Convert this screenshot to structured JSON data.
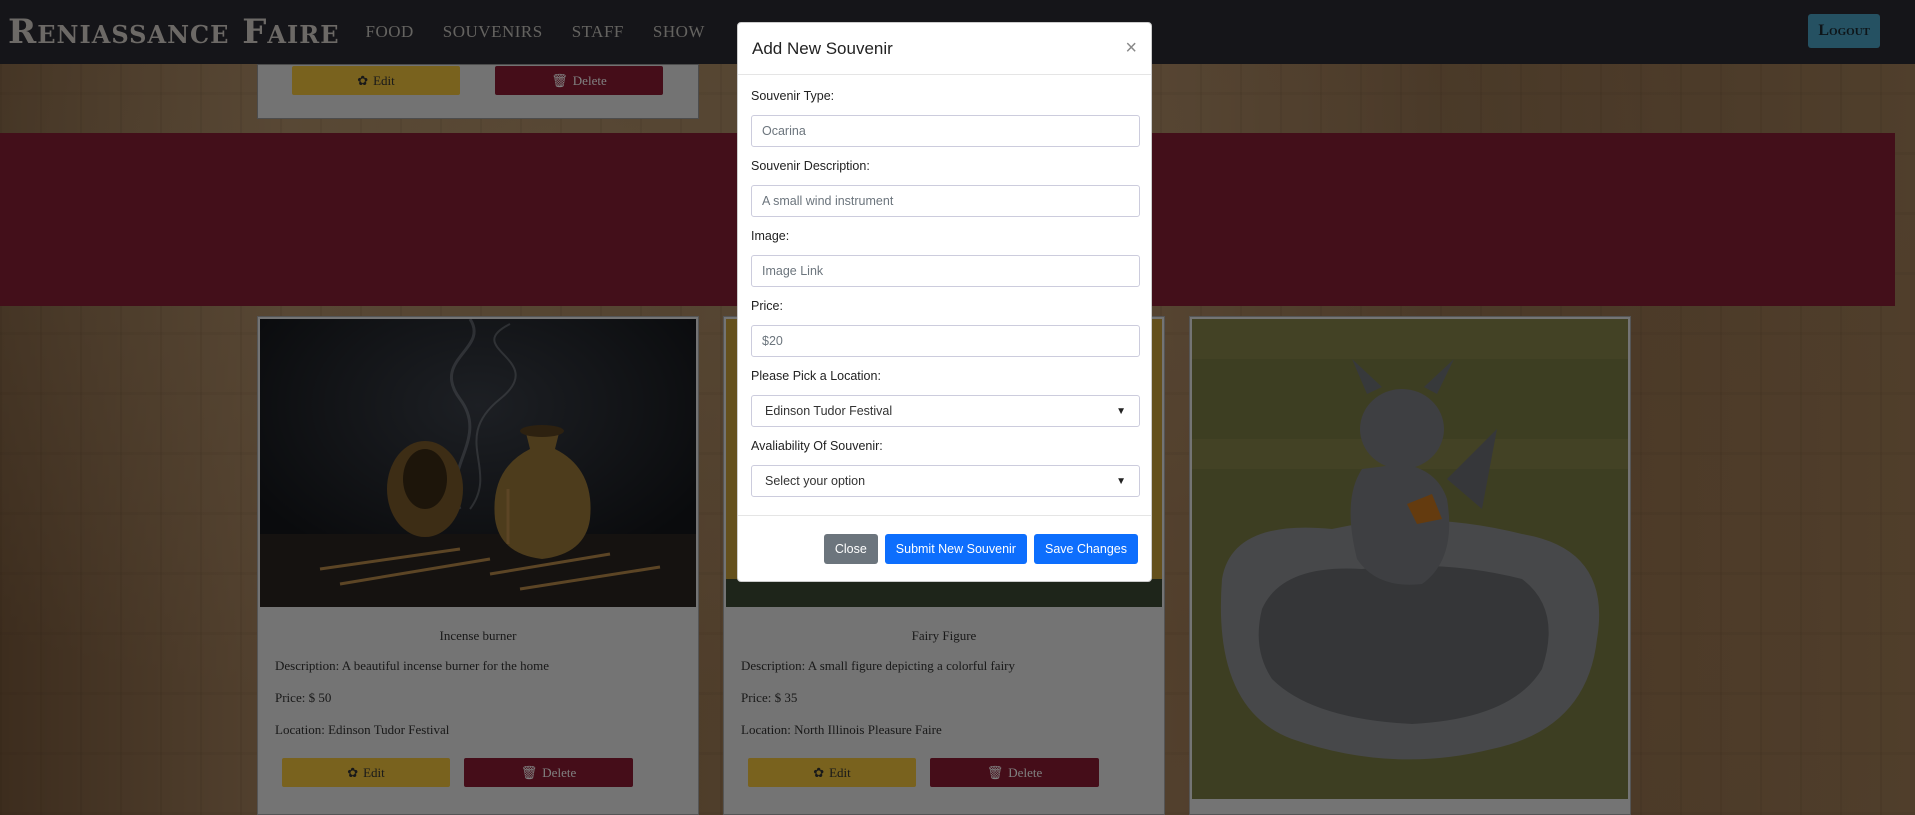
{
  "nav": {
    "brand": "Reniassance Faire",
    "links": [
      "FOOD",
      "SOUVENIRS",
      "STAFF",
      "SHOW"
    ],
    "logout": "Logout"
  },
  "top_card": {
    "edit": "Edit",
    "delete": "Delete"
  },
  "cards": [
    {
      "title": "Incense burner",
      "description": "Description: A beautiful incense burner for the home",
      "price": "Price: $ 50",
      "location": "Location: Edinson Tudor Festival",
      "edit": "Edit",
      "delete": "Delete"
    },
    {
      "title": "Fairy Figure",
      "description": "Description: A small figure depicting a colorful fairy",
      "price": "Price: $ 35",
      "location": "Location: North Illinois Pleasure Faire",
      "edit": "Edit",
      "delete": "Delete"
    }
  ],
  "modal": {
    "title": "Add New Souvenir",
    "close_symbol": "×",
    "type_label": "Souvenir Type:",
    "type_placeholder": "Ocarina",
    "desc_label": "Souvenir Description:",
    "desc_placeholder": "A small wind instrument",
    "image_label": "Image:",
    "image_placeholder": "Image Link",
    "price_label": "Price:",
    "price_placeholder": "$20",
    "location_label": "Please Pick a Location:",
    "location_selected": "Edinson Tudor Festival",
    "availability_label": "Avaliability Of Souvenir:",
    "availability_selected": "Select your option",
    "close_button": "Close",
    "submit_button": "Submit New Souvenir",
    "save_button": "Save Changes"
  },
  "colors": {
    "navbar": "#2b2a33",
    "banner": "#861f34",
    "edit": "#f2c53d",
    "delete": "#8b1a32",
    "primary": "#0d6efd",
    "secondary": "#6c757d"
  }
}
